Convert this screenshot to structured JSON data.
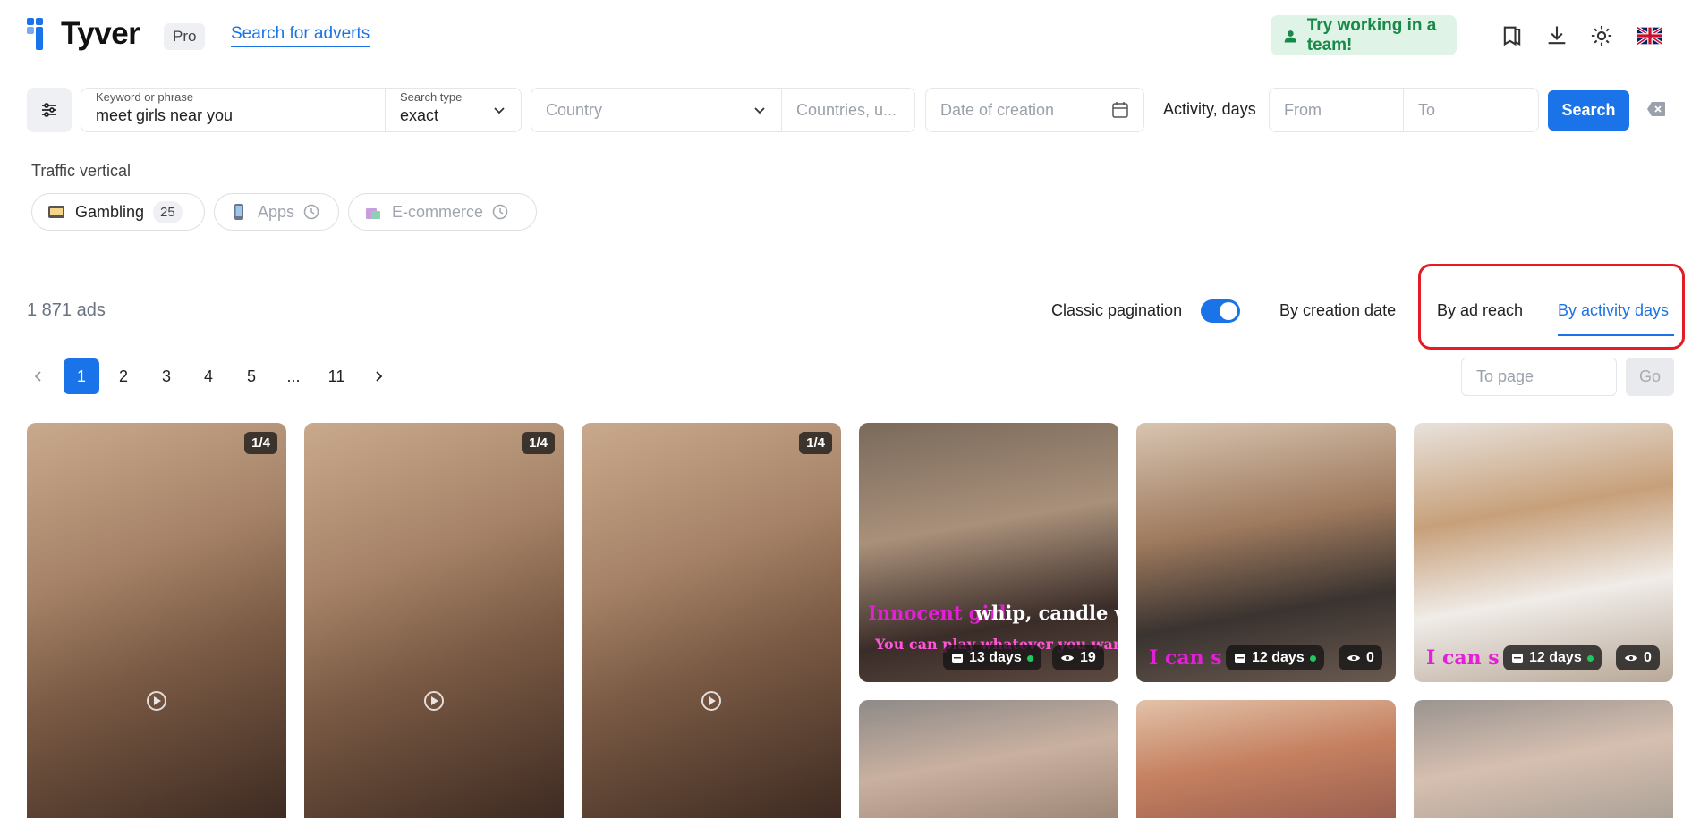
{
  "header": {
    "logo_text": "Tyver",
    "pro_badge": "Pro",
    "search_link": "Search for adverts",
    "team_button": "Try working in a team!",
    "icons": [
      "bookmarks-icon",
      "download-icon",
      "settings-icon",
      "uk-flag-icon"
    ]
  },
  "search": {
    "keyword_label": "Keyword or phrase",
    "keyword_value": "meet girls near you",
    "type_label": "Search type",
    "type_value": "exact",
    "country_placeholder": "Country",
    "countries_placeholder": "Countries, u...",
    "date_placeholder": "Date of creation",
    "activity_label": "Activity, days",
    "from_placeholder": "From",
    "to_placeholder": "To",
    "search_button": "Search"
  },
  "traffic_vertical": {
    "title": "Traffic vertical",
    "chips": [
      {
        "label": "Gambling",
        "count": "25"
      },
      {
        "label": "Apps"
      },
      {
        "label": "E-commerce"
      }
    ]
  },
  "results": {
    "ads_count": "1 871 ads",
    "classic_pagination_label": "Classic pagination",
    "classic_pagination_on": true,
    "sort_options": [
      "By creation date",
      "By ad reach",
      "By activity days"
    ],
    "active_sort": "By activity days"
  },
  "pagination": {
    "pages": [
      "1",
      "2",
      "3",
      "4",
      "5",
      "...",
      "11"
    ],
    "current": "1",
    "to_page_placeholder": "To page",
    "go_button": "Go"
  },
  "ads": [
    {
      "badge": "1/4"
    },
    {
      "badge": "1/4"
    },
    {
      "badge": "1/4"
    },
    {
      "days": "13 days",
      "views": "19",
      "overlay_1": "Innocent girl",
      "overlay_2": "whip, candle wax",
      "overlay_3": "You can play whatever you want"
    },
    {
      "days": "12 days",
      "views": "0",
      "overlay_1": "I can s"
    },
    {
      "days": "12 days",
      "views": "0",
      "overlay_1": "I can s"
    }
  ],
  "colors": {
    "accent": "#1a73e8",
    "team_bg": "#dff3e6",
    "team_text": "#178a47",
    "highlight_border": "#e51c23",
    "active_dot": "#22c55e"
  }
}
